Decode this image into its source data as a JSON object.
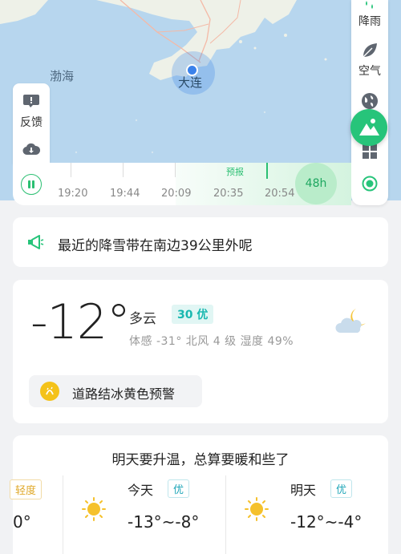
{
  "map": {
    "sea_label": "渤海",
    "city_label": "大连"
  },
  "left_panel": {
    "feedback_label": "反馈"
  },
  "right_panel": {
    "layers": [
      {
        "label": "降雨",
        "icon": "rain-icon"
      },
      {
        "label": "空气",
        "icon": "leaf-icon"
      }
    ]
  },
  "timeline": {
    "times": [
      "19:20",
      "19:44",
      "20:09",
      "20:35",
      "20:54"
    ],
    "forecast_label": "预报",
    "range_label": "48h"
  },
  "snow_notice": {
    "text": "最近的降雪带在南边39公里外呢"
  },
  "now": {
    "temperature": "-12°",
    "condition": "多云",
    "aqi": "30 优",
    "details": "体感 -31°  北风 4 级  湿度 49%",
    "warning": "道路结冰黄色预警",
    "accent_color": "#27c47a"
  },
  "forecast": {
    "headline": "明天要升温，总算要暖和些了",
    "partial_badge": "轻度",
    "partial_temp": "0°",
    "days": [
      {
        "name": "今天",
        "aqi": "优",
        "temp": "-13°~-8°"
      },
      {
        "name": "明天",
        "aqi": "优",
        "temp": "-12°~-4°"
      }
    ]
  }
}
